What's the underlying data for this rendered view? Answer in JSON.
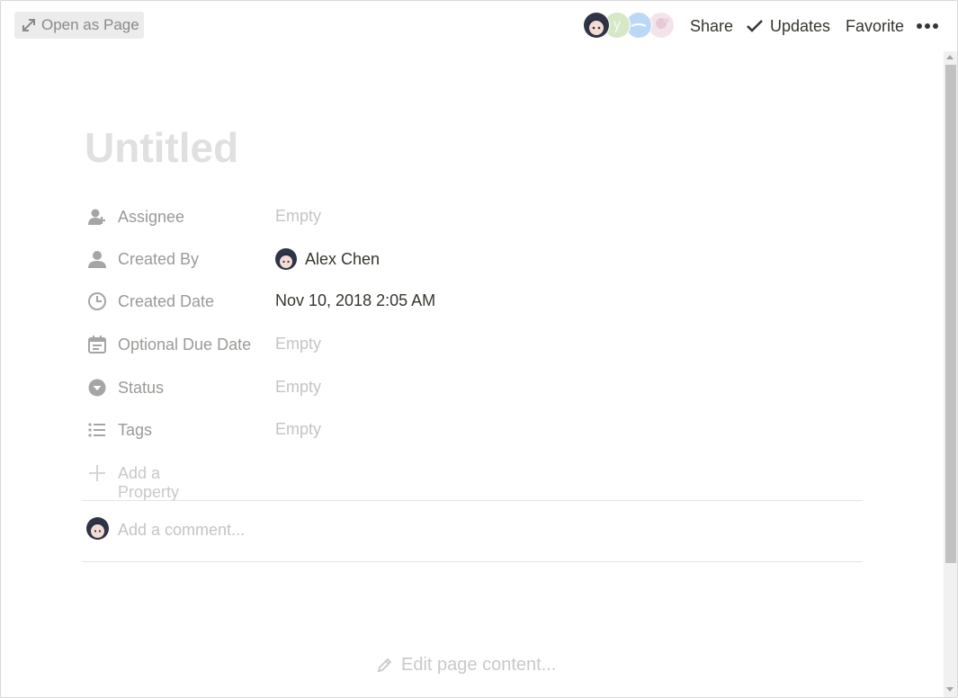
{
  "header": {
    "open_as_page": "Open as Page",
    "share": "Share",
    "updates": "Updates",
    "favorite": "Favorite",
    "avatar_initial": "y"
  },
  "page": {
    "title": "Untitled"
  },
  "properties": [
    {
      "label": "Assignee",
      "value": "Empty",
      "icon": "person-plus-icon"
    },
    {
      "label": "Created By",
      "value": "Alex Chen",
      "icon": "person-icon"
    },
    {
      "label": "Created Date",
      "value": "Nov 10, 2018 2:05 AM",
      "icon": "clock-icon"
    },
    {
      "label": "Optional Due Date",
      "value": "Empty",
      "icon": "calendar-icon"
    },
    {
      "label": "Status",
      "value": "Empty",
      "icon": "select-circle-icon"
    },
    {
      "label": "Tags",
      "value": "Empty",
      "icon": "list-icon"
    }
  ],
  "add_property": "Add a Property",
  "comment": {
    "placeholder": "Add a comment..."
  },
  "edit_content": "Edit page content...",
  "colors": {
    "accent_text": "#37352f",
    "muted": "#9b9a97",
    "placeholder": "#c4c4c4"
  }
}
